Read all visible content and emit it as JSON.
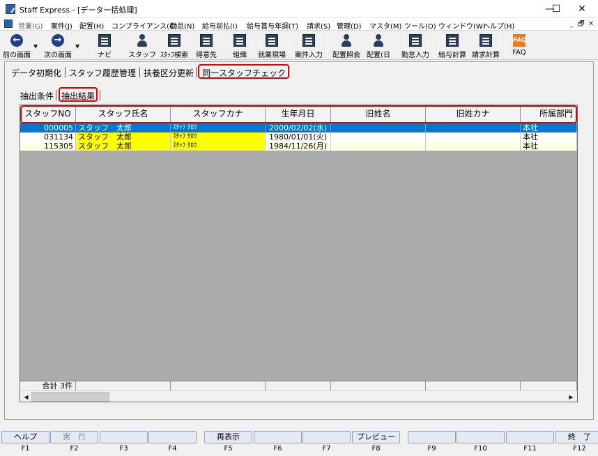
{
  "window": {
    "title": "Staff Express - [データ一括処理]",
    "controls": [
      "—",
      "☐",
      "✕"
    ]
  },
  "menu": [
    {
      "label": "営業(G)",
      "dim": true
    },
    {
      "label": "案件(J)"
    },
    {
      "label": "配置(H)"
    },
    {
      "label": "コンプライアンス(C)"
    },
    {
      "label": "勤怠(N)"
    },
    {
      "label": "給与前払(I)"
    },
    {
      "label": "給与賞与年調(T)"
    },
    {
      "label": "請求(S)"
    },
    {
      "label": "管理(D)"
    },
    {
      "label": "マスタ(M)"
    },
    {
      "label": "ツール(O)"
    },
    {
      "label": "ウィンドウ(W)"
    },
    {
      "label": "ヘルプ(H)"
    }
  ],
  "mdi_controls": [
    "_",
    "🗗",
    "✕"
  ],
  "toolbar": {
    "prev": "前の画面",
    "next": "次の画面",
    "navi": "ナビ",
    "staff": "スタッフ",
    "staff_search": "ｽﾀｯﾌ検索",
    "client": "得意先",
    "org": "組織",
    "site": "就業現場",
    "case_input": "案件入力",
    "placement_ref": "配置照会",
    "placement_day": "配置(日",
    "attendance": "勤怠入力",
    "payroll": "給与計算",
    "billing": "請求計算",
    "faq": "FAQ"
  },
  "tabs_top": [
    {
      "label": "データ初期化"
    },
    {
      "label": "スタッフ履歴管理"
    },
    {
      "label": "扶養区分更新"
    },
    {
      "label": "同一スタッフチェック",
      "active": true
    }
  ],
  "tabs_sub": [
    {
      "label": "抽出条件"
    },
    {
      "label": "抽出結果",
      "active": true
    }
  ],
  "grid": {
    "columns": [
      "スタッフNO",
      "スタッフ氏名",
      "スタッフカナ",
      "生年月日",
      "旧姓名",
      "旧姓カナ",
      "所属部門"
    ],
    "rows": [
      {
        "no": "000005",
        "name": "スタッフ　太郎",
        "kana": "ｽﾀｯﾌ ﾀﾛｳ",
        "birth": "2000/02/02(水)",
        "old_name": "",
        "old_kana": "",
        "dept": "本社",
        "style": "selected"
      },
      {
        "no": "031134",
        "name": "スタッフ　太郎",
        "kana": "ｽﾀｯﾌ ﾀﾛｳ",
        "birth": "1980/01/01(火)",
        "old_name": "",
        "old_kana": "",
        "dept": "本社",
        "style": "yellow"
      },
      {
        "no": "115305",
        "name": "スタッフ　太郎",
        "kana": "ｽﾀｯﾌ ﾀﾛｳ",
        "birth": "1984/11/26(月)",
        "old_name": "",
        "old_kana": "",
        "dept": "本社",
        "style": "yellow"
      }
    ],
    "total": "合計  3件"
  },
  "fkeys": [
    {
      "label": "ヘルプ",
      "key": "F1"
    },
    {
      "label": "実　行",
      "key": "F2",
      "disabled": true
    },
    {
      "label": "",
      "key": "F3"
    },
    {
      "label": "",
      "key": "F4"
    },
    {
      "label": "再表示",
      "key": "F5"
    },
    {
      "label": "",
      "key": "F6"
    },
    {
      "label": "",
      "key": "F7"
    },
    {
      "label": "プレビュー",
      "key": "F8"
    },
    {
      "label": "",
      "key": "F9"
    },
    {
      "label": "",
      "key": "F10"
    },
    {
      "label": "",
      "key": "F11"
    },
    {
      "label": "終　了",
      "key": "F12"
    }
  ],
  "colors": {
    "selected_row": "#0078d7",
    "highlight_yellow": "#ffff00",
    "pale_row": "#ffffe1",
    "red_frame": "#e00000"
  }
}
